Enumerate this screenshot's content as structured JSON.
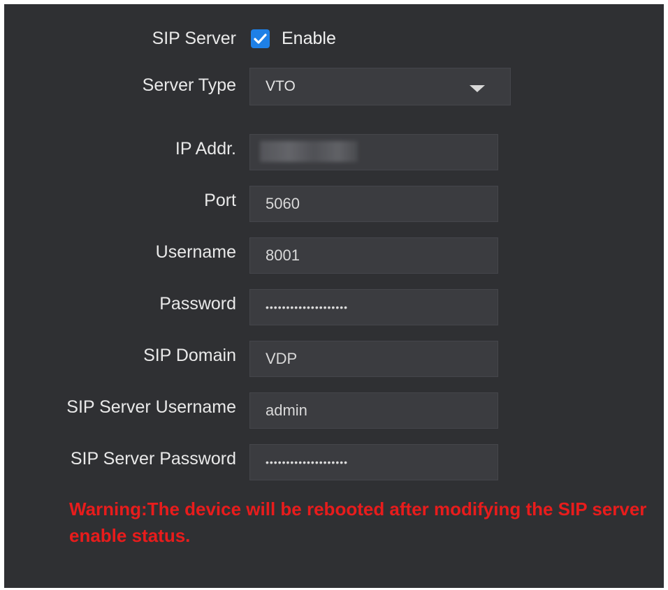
{
  "sip_server": {
    "label": "SIP Server",
    "enable_label": "Enable",
    "enabled": true
  },
  "server_type": {
    "label": "Server Type",
    "value": "VTO"
  },
  "ip_addr": {
    "label": "IP Addr.",
    "value": ""
  },
  "port": {
    "label": "Port",
    "value": "5060"
  },
  "username": {
    "label": "Username",
    "value": "8001"
  },
  "password": {
    "label": "Password",
    "value": "••••••••••••••••••••"
  },
  "sip_domain": {
    "label": "SIP Domain",
    "value": "VDP"
  },
  "sip_server_username": {
    "label": "SIP Server Username",
    "value": "admin"
  },
  "sip_server_password": {
    "label": "SIP Server Password",
    "value": "••••••••••••••••••••"
  },
  "warning": "Warning:The device will be rebooted after modifying the SIP server enable status.",
  "colors": {
    "background": "#2f3033",
    "field": "#3b3c40",
    "checkbox": "#1e80e6",
    "warning": "#e81c1c"
  },
  "icons": {
    "checkbox": "checkmark-icon",
    "dropdown": "caret-down-icon"
  }
}
